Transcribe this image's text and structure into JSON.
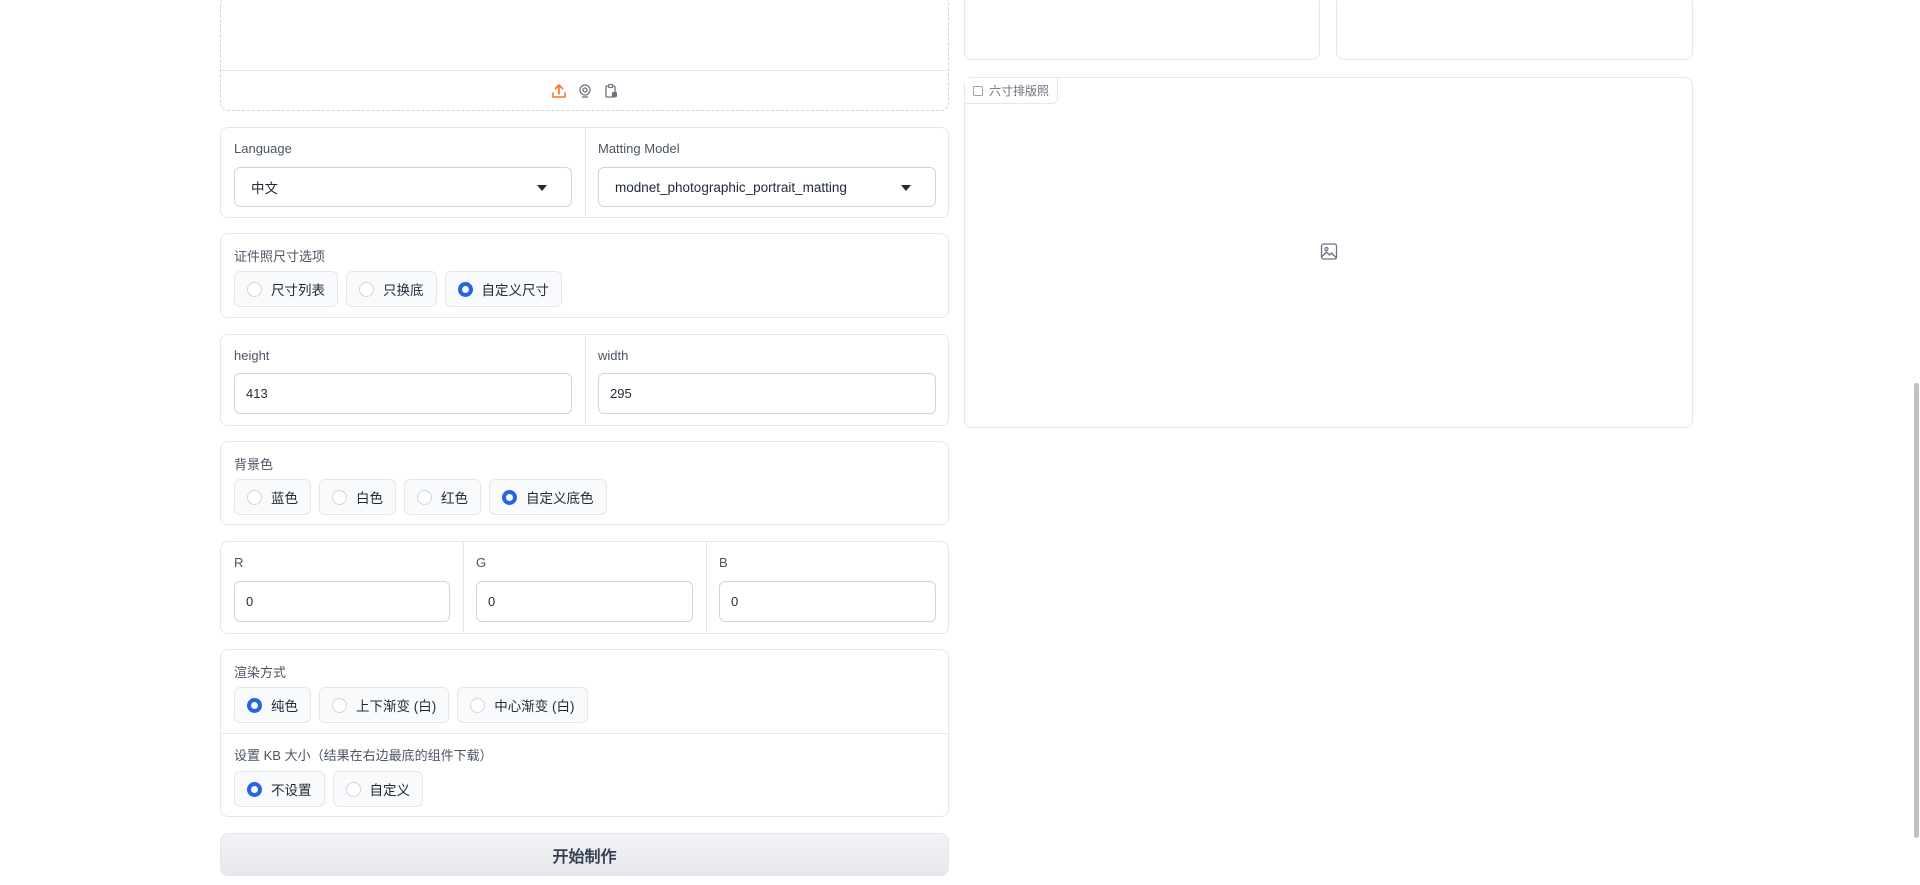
{
  "upload": {
    "icons": [
      "upload-icon",
      "webcam-icon",
      "clipboard-icon"
    ]
  },
  "language": {
    "label": "Language",
    "value": "中文"
  },
  "matting_model": {
    "label": "Matting Model",
    "value": "modnet_photographic_portrait_matting"
  },
  "size_options": {
    "label": "证件照尺寸选项",
    "options": [
      "尺寸列表",
      "只换底",
      "自定义尺寸"
    ],
    "selected": "自定义尺寸"
  },
  "dims": {
    "height_label": "height",
    "height_value": "413",
    "width_label": "width",
    "width_value": "295"
  },
  "background": {
    "label": "背景色",
    "options": [
      "蓝色",
      "白色",
      "红色",
      "自定义底色"
    ],
    "selected": "自定义底色"
  },
  "rgb": {
    "r_label": "R",
    "r_value": "0",
    "g_label": "G",
    "g_value": "0",
    "b_label": "B",
    "b_value": "0"
  },
  "render_mode": {
    "label": "渲染方式",
    "options": [
      "纯色",
      "上下渐变 (白)",
      "中心渐变 (白)"
    ],
    "selected": "纯色"
  },
  "kb_size": {
    "label": "设置 KB 大小（结果在右边最底的组件下载）",
    "options": [
      "不设置",
      "自定义"
    ],
    "selected": "不设置"
  },
  "start_button": "开始制作",
  "six_inch": {
    "label": "六寸排版照"
  },
  "colors": {
    "accent": "#2563eb",
    "upload_icon": "#f97316",
    "border": "#e5e7eb"
  }
}
